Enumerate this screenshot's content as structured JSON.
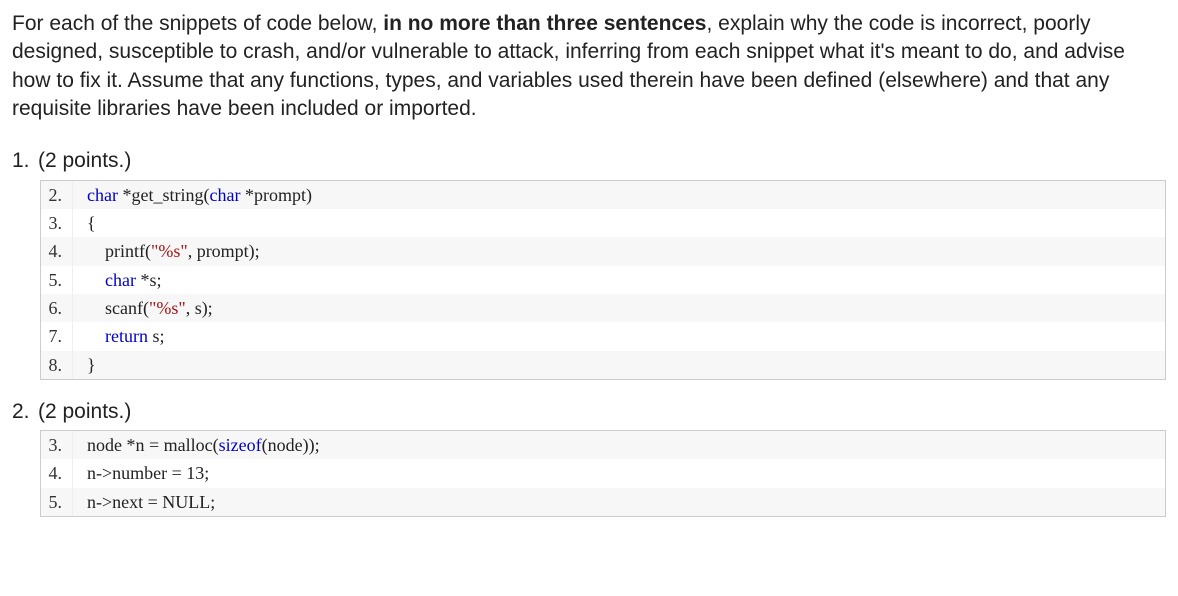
{
  "instructions": {
    "part1": "For each of the snippets of code below, ",
    "bold": "in no more than three sentences",
    "part2": ", explain why the code is incorrect, poorly designed, susceptible to crash, and/or vulnerable to attack, inferring from each snippet what it's meant to do, and advise how to fix it. Assume that any functions, types, and variables used therein have been defined (elsewhere) and that any requisite libraries have been included or imported."
  },
  "questions": [
    {
      "number": "1.",
      "points": "(2 points.)",
      "startLine": 2,
      "code": [
        [
          {
            "t": "char",
            "c": "kw"
          },
          {
            "t": " *get_string("
          },
          {
            "t": "char",
            "c": "kw"
          },
          {
            "t": " *prompt)"
          }
        ],
        [
          {
            "t": "{"
          }
        ],
        [
          {
            "t": "    printf("
          },
          {
            "t": "\"%s\"",
            "c": "str"
          },
          {
            "t": ", prompt);"
          }
        ],
        [
          {
            "t": "    "
          },
          {
            "t": "char",
            "c": "kw"
          },
          {
            "t": " *s;"
          }
        ],
        [
          {
            "t": "    scanf("
          },
          {
            "t": "\"%s\"",
            "c": "str"
          },
          {
            "t": ", s);"
          }
        ],
        [
          {
            "t": "    "
          },
          {
            "t": "return",
            "c": "kw"
          },
          {
            "t": " s;"
          }
        ],
        [
          {
            "t": "}"
          }
        ]
      ]
    },
    {
      "number": "2.",
      "points": "(2 points.)",
      "startLine": 3,
      "code": [
        [
          {
            "t": "node *n = malloc("
          },
          {
            "t": "sizeof",
            "c": "kw"
          },
          {
            "t": "(node));"
          }
        ],
        [
          {
            "t": "n->number = 13;"
          }
        ],
        [
          {
            "t": "n->next = NULL;"
          }
        ]
      ]
    }
  ]
}
